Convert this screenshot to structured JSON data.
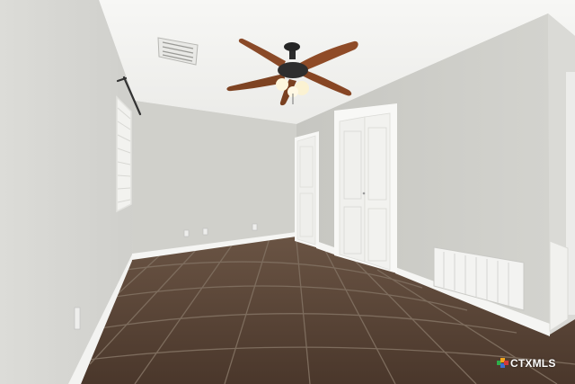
{
  "scene": {
    "colors": {
      "ceiling": "#f4f4f2",
      "left_wall": "#d7d7d3",
      "back_wall": "#d1d1cc",
      "right_wall": "#cbcbc6",
      "baseboard": "#f6f6f4",
      "floor_tile": "#5a4536",
      "grout": "#7a6a5c",
      "door": "#f1f1ef",
      "fan_blade": "#8a4a28",
      "fan_body": "#2b2b2b"
    },
    "icons": [
      "ceiling-fan-icon",
      "air-vent-icon",
      "curtain-rod-icon",
      "outlet-icon"
    ]
  },
  "watermark": {
    "text": "CTXMLS"
  }
}
